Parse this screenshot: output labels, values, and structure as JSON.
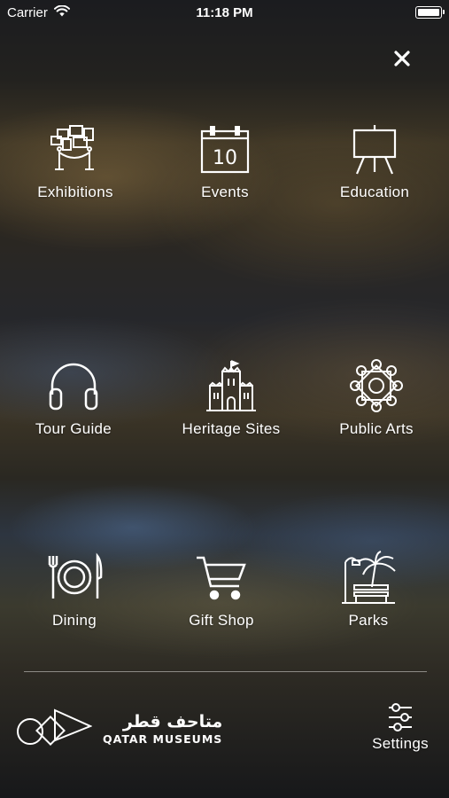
{
  "status_bar": {
    "carrier": "Carrier",
    "time": "11:18 PM",
    "battery_level_percent": 100,
    "icons": [
      "wifi-icon",
      "battery-icon"
    ]
  },
  "header": {
    "close_icon": "close-icon"
  },
  "menu": {
    "items": [
      {
        "label": "Exhibitions",
        "icon": "exhibition-frames-icon"
      },
      {
        "label": "Events",
        "icon": "calendar-icon",
        "icon_text": "10"
      },
      {
        "label": "Education",
        "icon": "easel-board-icon"
      },
      {
        "label": "Tour Guide",
        "icon": "headphones-icon"
      },
      {
        "label": "Heritage Sites",
        "icon": "heritage-building-icon"
      },
      {
        "label": "Public Arts",
        "icon": "geometric-rosette-icon"
      },
      {
        "label": "Dining",
        "icon": "plate-fork-knife-icon"
      },
      {
        "label": "Gift Shop",
        "icon": "shopping-cart-icon"
      },
      {
        "label": "Parks",
        "icon": "palm-tree-bench-icon"
      }
    ]
  },
  "footer": {
    "logo_arabic": "متاحف قطر",
    "logo_latin": "QATAR MUSEUMS",
    "logo_icon": "qatar-museums-shapes-logo",
    "settings_label": "Settings",
    "settings_icon": "sliders-icon"
  },
  "colors": {
    "foreground": "#ffffff",
    "background_dark": "#1b1c1f"
  }
}
